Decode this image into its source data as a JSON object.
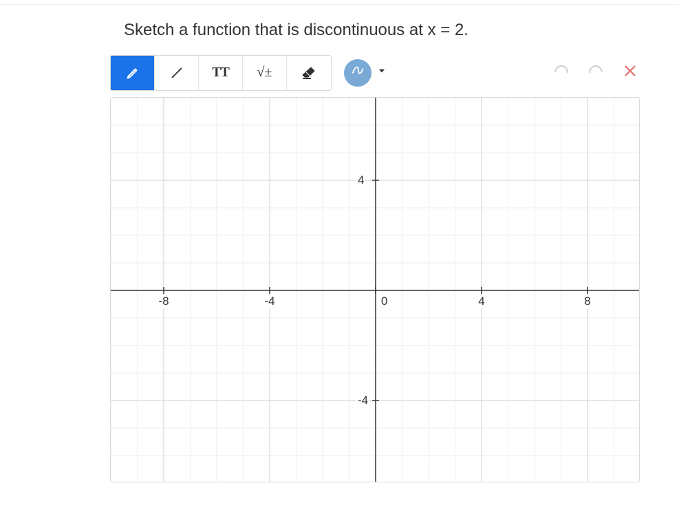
{
  "prompt": "Sketch a function that is discontinuous at x = 2.",
  "toolbar": {
    "pen_tool": "pen-icon",
    "line_tool": "line-icon",
    "text_tool_label": "TT",
    "math_tool_label": "√±",
    "eraser_tool": "eraser-icon",
    "scribble_tool": "scribble-icon"
  },
  "chart_data": {
    "type": "grid",
    "x_range": [
      -10,
      10
    ],
    "y_range": [
      -7,
      7
    ],
    "x_ticks": [
      -8,
      -4,
      0,
      4,
      8
    ],
    "y_ticks": [
      -4,
      4
    ],
    "x_tick_labels": [
      "-8",
      "-4",
      "0",
      "4",
      "8"
    ],
    "y_tick_labels": [
      "-4",
      "4"
    ],
    "minor_grid_step": 1,
    "major_grid_step": 4,
    "title": "",
    "xlabel": "",
    "ylabel": ""
  }
}
